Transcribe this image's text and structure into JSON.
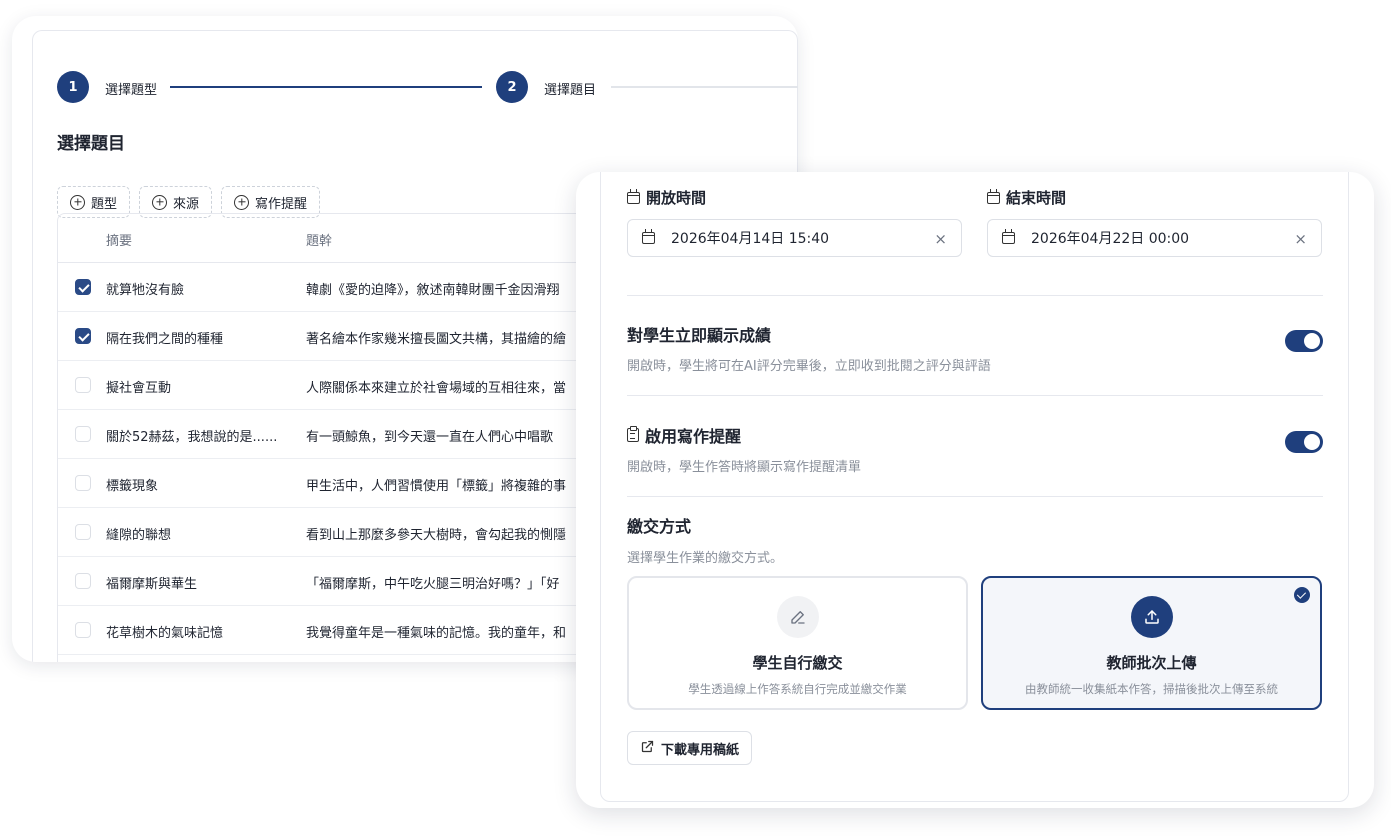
{
  "stepper": {
    "step1": {
      "number": "1",
      "label": "選擇題型"
    },
    "step2": {
      "number": "2",
      "label": "選擇題目"
    }
  },
  "question_panel": {
    "title": "選擇題目",
    "filters": [
      "題型",
      "來源",
      "寫作提醒"
    ],
    "columns": {
      "summary": "摘要",
      "stem": "題幹"
    },
    "rows": [
      {
        "checked": true,
        "summary": "就算牠沒有臉",
        "stem": "韓劇《愛的迫降》，敘述南韓財團千金因滑翔"
      },
      {
        "checked": true,
        "summary": "隔在我們之間的種種",
        "stem": "著名繪本作家幾米擅長圖文共構，其描繪的繪"
      },
      {
        "checked": false,
        "summary": "擬社會互動",
        "stem": "人際關係本來建立於社會場域的互相往來，當"
      },
      {
        "checked": false,
        "summary": "關於52赫茲，我想說的是......",
        "stem": "有一頭鯨魚，到今天還一直在人們心中唱歌"
      },
      {
        "checked": false,
        "summary": "標籤現象",
        "stem": "甲生活中，人們習慣使用「標籤」將複雜的事"
      },
      {
        "checked": false,
        "summary": "縫隙的聯想",
        "stem": "看到山上那麼多參天大樹時，會勾起我的惻隱"
      },
      {
        "checked": false,
        "summary": "福爾摩斯與華生",
        "stem": "「福爾摩斯，中午吃火腿三明治好嗎？」「好"
      },
      {
        "checked": false,
        "summary": "花草樹木的氣味記憶",
        "stem": "我覺得童年是一種氣味的記憶。我的童年，和"
      }
    ]
  },
  "settings_panel": {
    "open_time": {
      "label": "開放時間",
      "value": "2026年04月14日 15:40"
    },
    "close_time": {
      "label": "結束時間",
      "value": "2026年04月22日 00:00"
    },
    "clear_icon": "×",
    "show_score": {
      "title": "對學生立即顯示成績",
      "desc": "開啟時，學生將可在AI評分完畢後，立即收到批閱之評分與評語",
      "enabled": true
    },
    "writing_reminder": {
      "title": "啟用寫作提醒",
      "desc": "開啟時，學生作答時將顯示寫作提醒清單",
      "enabled": true
    },
    "submission": {
      "title": "繳交方式",
      "desc": "選擇學生作業的繳交方式。",
      "options": [
        {
          "title": "學生自行繳交",
          "desc": "學生透過線上作答系統自行完成並繳交作業",
          "icon": "pencil-icon",
          "selected": false
        },
        {
          "title": "教師批次上傳",
          "desc": "由教師統一收集紙本作答，掃描後批次上傳至系統",
          "icon": "upload-icon",
          "selected": true
        }
      ]
    },
    "download_label": "下載專用稿紙"
  },
  "colors": {
    "primary": "#1f3f7d",
    "muted_text": "#8a909b",
    "border": "#e6e8ee"
  }
}
